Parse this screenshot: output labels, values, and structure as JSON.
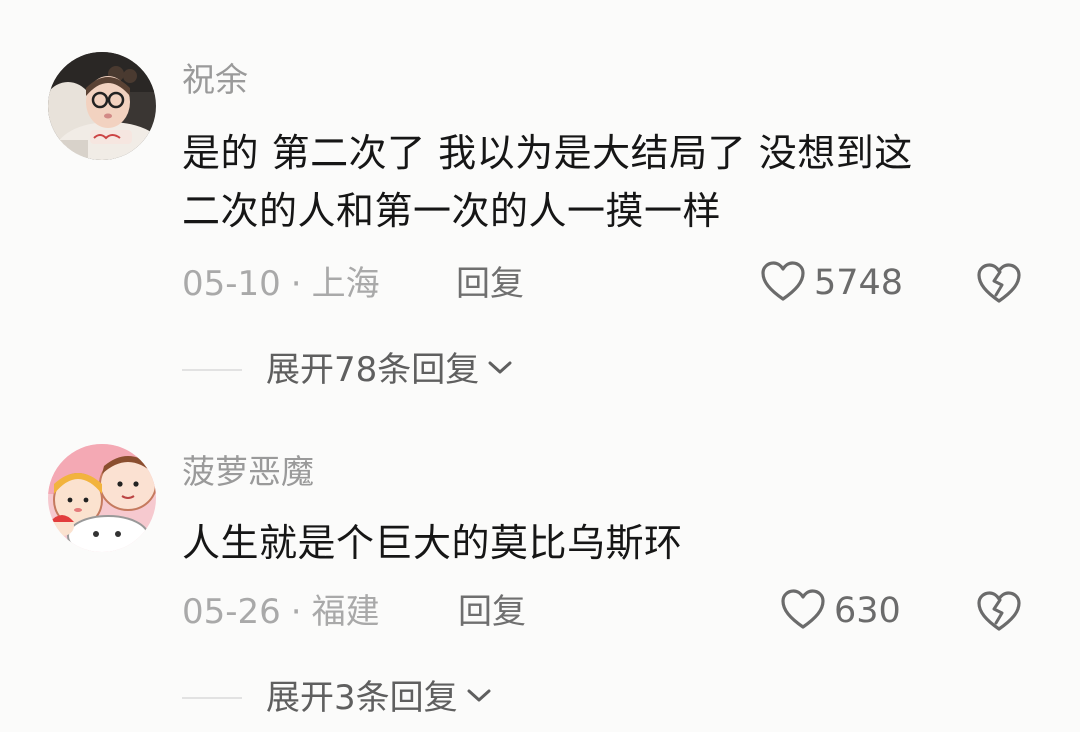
{
  "comments": [
    {
      "username": "祝余",
      "text_line1": "是的 第二次了 我以为是大结局了 没想到这",
      "text_line2": "二次的人和第一次的人一摸一样",
      "date": "05-10",
      "separator": "·",
      "location": "上海",
      "reply_label": "回复",
      "like_count": "5748",
      "expand_label": "展开78条回复"
    },
    {
      "username": "菠萝恶魔",
      "text_line1": "人生就是个巨大的莫比乌斯环",
      "date": "05-26",
      "separator": "·",
      "location": "福建",
      "reply_label": "回复",
      "like_count": "630",
      "expand_label": "展开3条回复"
    }
  ],
  "icons": {
    "like": "heart-outline-icon",
    "dislike": "broken-heart-icon",
    "expand": "chevron-down-icon"
  }
}
